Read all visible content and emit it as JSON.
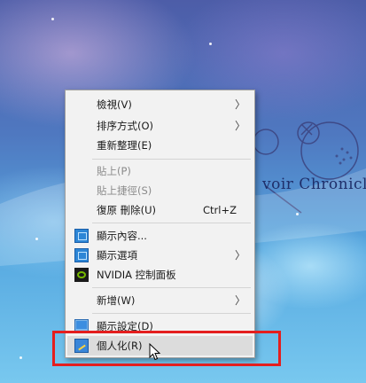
{
  "wallpaper": {
    "text": "voir Chronicle"
  },
  "context_menu": {
    "items": [
      {
        "label": "檢視(V)",
        "submenu": true
      },
      {
        "label": "排序方式(O)",
        "submenu": true
      },
      {
        "label": "重新整理(E)"
      },
      {
        "label": "貼上(P)",
        "disabled": true
      },
      {
        "label": "貼上捷徑(S)",
        "disabled": true
      },
      {
        "label": "復原 刪除(U)",
        "shortcut": "Ctrl+Z"
      },
      {
        "label": "顯示內容...",
        "icon": "display-content-icon"
      },
      {
        "label": "顯示選項",
        "icon": "display-options-icon",
        "submenu": true
      },
      {
        "label": "NVIDIA 控制面板",
        "icon": "nvidia-icon"
      },
      {
        "label": "新增(W)",
        "submenu": true
      },
      {
        "label": "顯示設定(D)",
        "icon": "display-settings-icon"
      },
      {
        "label": "個人化(R)",
        "icon": "personalize-icon",
        "hovered": true
      }
    ],
    "arrow_glyph": "〉"
  },
  "annotation": {
    "highlight_color": "#e41e1e"
  }
}
